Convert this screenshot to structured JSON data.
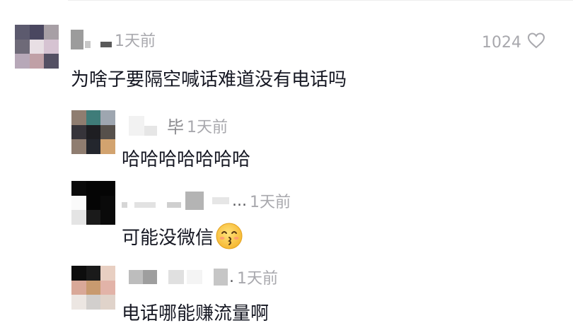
{
  "comments": [
    {
      "time": "1天前",
      "text": "为啥子要隔空喊话难道没有电话吗",
      "like_count": "1024",
      "avatar_colors": [
        "#5c5a6e",
        "#4a4760",
        "#a79fa5",
        "#6e6a78",
        "#e8dfe4",
        "#d6c3d2",
        "#b7a8b8",
        "#c0a0a6",
        "#545063"
      ]
    },
    {
      "name_suffix": "毕",
      "time": "1天前",
      "text": "哈哈哈哈哈哈哈",
      "avatar_colors": [
        "#8f7d70",
        "#3f7c79",
        "#9ea6b0",
        "#36343a",
        "#1e1e22",
        "#56504b",
        "#8f7d70",
        "#23262d",
        "#d2a36f"
      ]
    },
    {
      "name_suffix": "...",
      "time": "1天前",
      "text": "可能没微信",
      "emoji": "kissing-smiling-eyes",
      "avatar_colors": [
        "#0a0a0a",
        "#050505",
        "#050505",
        "#fafafa",
        "#050505",
        "#0a0a0a",
        "#e4e4e4",
        "#1a1a1a",
        "#0a0a0a"
      ]
    },
    {
      "name_suffix": ".",
      "time": "1天前",
      "text": "电话哪能赚流量啊",
      "avatar_colors": [
        "#0d0d0d",
        "#1a1a1a",
        "#e8cfc2",
        "#d9a898",
        "#c89a6f",
        "#e2b3a8",
        "#ece6e2",
        "#d2cfcd",
        "#e0d3ca"
      ]
    }
  ],
  "colors": {
    "text": "#161823",
    "meta": "#a8a8ad",
    "emoji_face": "#ffc94a"
  },
  "icons": {
    "like": "heart-outline-icon"
  }
}
